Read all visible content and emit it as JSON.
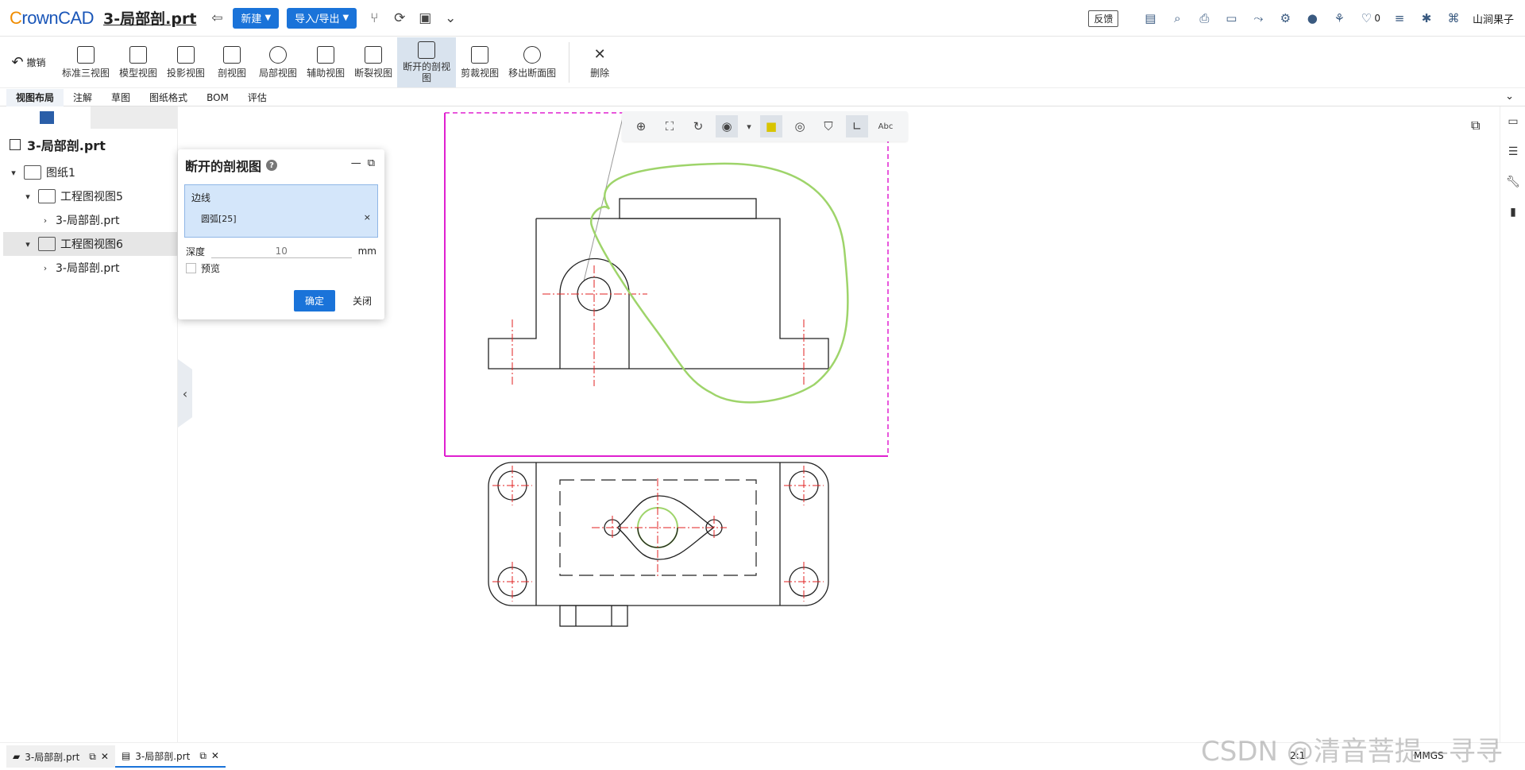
{
  "app": {
    "logo": "CrownCAD",
    "filename": "3-局部剖.prt"
  },
  "topbar": {
    "new_label": "新建",
    "import_export_label": "导入/导出",
    "feedback_label": "反馈",
    "like_count": "0",
    "user_name": "山涧果子"
  },
  "ribbon": {
    "undo_label": "撤销",
    "items": [
      {
        "label": "标准三视图"
      },
      {
        "label": "模型视图"
      },
      {
        "label": "投影视图"
      },
      {
        "label": "剖视图"
      },
      {
        "label": "局部视图"
      },
      {
        "label": "辅助视图"
      },
      {
        "label": "断裂视图"
      },
      {
        "label": "断开的剖视图",
        "active": true
      },
      {
        "label": "剪裁视图"
      },
      {
        "label": "移出断面图"
      },
      {
        "label": "删除"
      }
    ]
  },
  "tabs": [
    "视图布局",
    "注解",
    "草图",
    "图纸格式",
    "BOM",
    "评估"
  ],
  "tree": {
    "root": "3-局部剖.prt",
    "sheet": "图纸1",
    "view5": "工程图视图5",
    "view5_child": "3-局部剖.prt",
    "view6": "工程图视图6",
    "view6_child": "3-局部剖.prt"
  },
  "dialog": {
    "title": "断开的剖视图",
    "edge_label": "边线",
    "edge_item": "圆弧[25]",
    "depth_label": "深度",
    "depth_value": "10",
    "depth_unit": "mm",
    "preview_label": "预览",
    "ok_label": "确定",
    "close_label": "关闭"
  },
  "bottom": {
    "tab1": "3-局部剖.prt",
    "tab2": "3-局部剖.prt",
    "scale": "2:1",
    "units": "MMGS"
  },
  "watermark": "CSDN @清音菩提—寻寻",
  "colors": {
    "accent": "#1a73d9",
    "boundary": "#e020d0",
    "centerline": "#e02020",
    "spline": "#9ed46a"
  }
}
